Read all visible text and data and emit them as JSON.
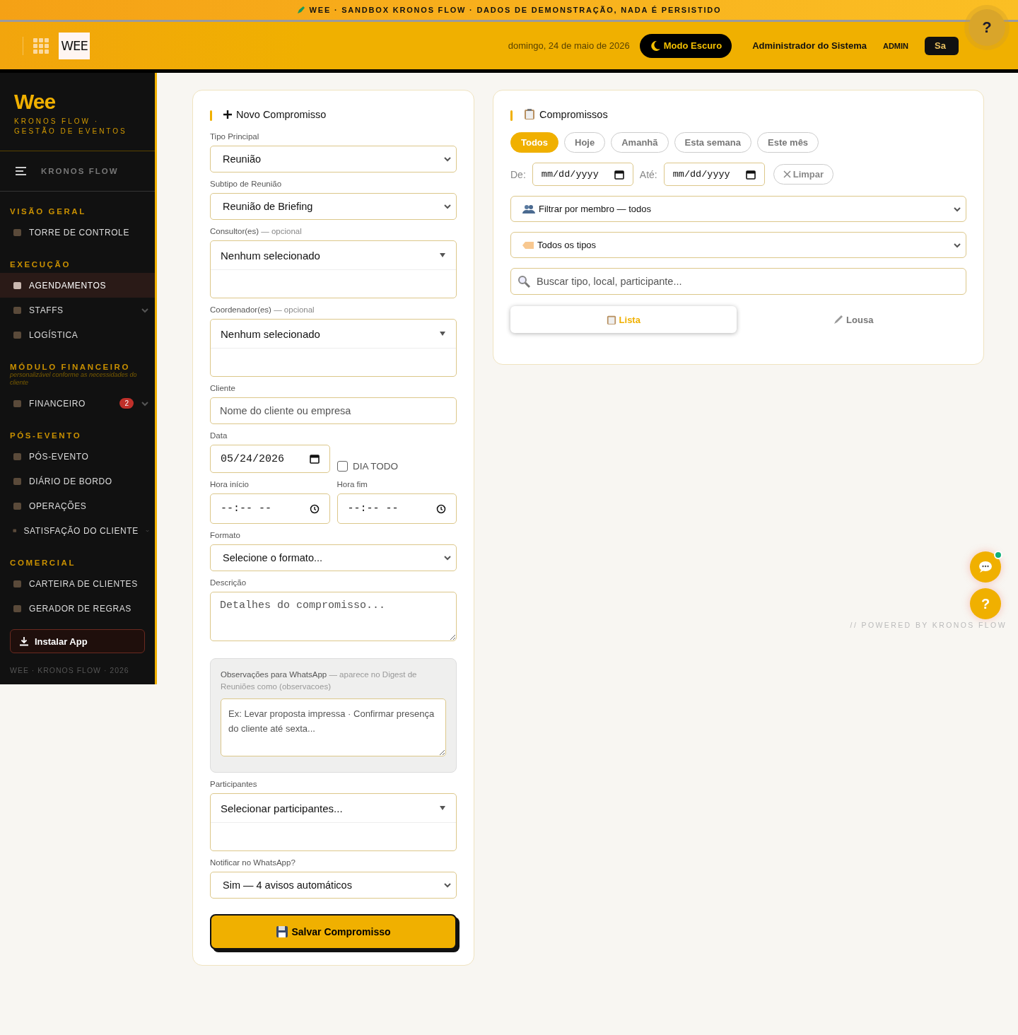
{
  "banner": {
    "text": "WEE · SANDBOX KRONOS FLOW · DADOS DE DEMONSTRAÇÃO, NADA É PERSISTIDO"
  },
  "header": {
    "logo": "WEE",
    "date": "domingo, 24 de maio de 2026",
    "dark_mode_button": "Modo Escuro",
    "user_name": "Administrador do Sistema",
    "role": "ADMIN",
    "logout_button": "Sa",
    "help_button": "?"
  },
  "sidebar": {
    "brand": "Wee",
    "tagline": "KRONOS FLOW · GESTÃO DE EVENTOS",
    "menu_label": "KRONOS FLOW",
    "sections": [
      {
        "title": "VISÃO GERAL",
        "items": [
          {
            "label": "TORRE DE CONTROLE",
            "selected": false,
            "expandable": false
          }
        ]
      },
      {
        "title": "EXECUÇÃO",
        "items": [
          {
            "label": "AGENDAMENTOS",
            "selected": true,
            "expandable": false
          },
          {
            "label": "STAFFS",
            "selected": false,
            "expandable": true
          },
          {
            "label": "LOGÍSTICA",
            "selected": false,
            "expandable": false
          }
        ]
      },
      {
        "title": "MÓDULO FINANCEIRO",
        "subtitle": "personalizável conforme as necessidades do cliente",
        "items": [
          {
            "label": "FINANCEIRO",
            "selected": false,
            "expandable": true,
            "badge": "2"
          }
        ]
      },
      {
        "title": "PÓS-EVENTO",
        "items": [
          {
            "label": "PÓS-EVENTO",
            "selected": false,
            "expandable": false
          },
          {
            "label": "DIÁRIO DE BORDO",
            "selected": false,
            "expandable": false
          },
          {
            "label": "OPERAÇÕES",
            "selected": false,
            "expandable": false
          },
          {
            "label": "SATISFAÇÃO DO CLIENTE",
            "selected": false,
            "expandable": true
          }
        ]
      },
      {
        "title": "COMERCIAL",
        "items": [
          {
            "label": "CARTEIRA DE CLIENTES",
            "selected": false,
            "expandable": false
          },
          {
            "label": "GERADOR DE REGRAS",
            "selected": false,
            "expandable": false
          }
        ]
      }
    ],
    "install_button": "Instalar App",
    "footer": "WEE · KRONOS FLOW · 2026"
  },
  "form": {
    "title": "Novo Compromisso",
    "fields": [
      {
        "kind": "select",
        "label": "Tipo Principal",
        "value": "Reunião"
      },
      {
        "kind": "select",
        "label": "Subtipo de Reunião",
        "value": "Reunião de Briefing"
      },
      {
        "kind": "multi",
        "label": "Consultor(es)",
        "hint": "— opcional",
        "value": "Nenhum selecionado"
      },
      {
        "kind": "multi",
        "label": "Coordenador(es)",
        "hint": "— opcional",
        "value": "Nenhum selecionado"
      },
      {
        "kind": "text",
        "label": "Cliente",
        "placeholder": "Nome do cliente ou empresa"
      },
      {
        "kind": "date",
        "label": "Data",
        "value": "05/24/2026",
        "checkbox": {
          "label": "DIA TODO",
          "checked": false
        }
      },
      {
        "kind": "times",
        "items": [
          {
            "label": "Hora início",
            "value": "--:-- --"
          },
          {
            "label": "Hora fim",
            "value": "--:-- --"
          }
        ]
      },
      {
        "kind": "select",
        "label": "Formato",
        "value": "Selecione o formato..."
      },
      {
        "kind": "textarea",
        "label": "Descrição",
        "placeholder": "Detalhes do compromisso..."
      },
      {
        "kind": "note",
        "label": "Observações para WhatsApp",
        "hint": "— aparece no Digest de Reuniões como (observacoes)",
        "placeholder": "Ex: Levar proposta impressa · Confirmar presença do cliente até sexta..."
      },
      {
        "kind": "multi",
        "label": "Participantes",
        "value": "Selecionar participantes..."
      },
      {
        "kind": "select",
        "label": "Notificar no WhatsApp?",
        "value": "Sim — 4 avisos automáticos"
      }
    ],
    "submit": "Salvar Compromisso"
  },
  "list": {
    "title": "Compromissos",
    "chips": [
      {
        "label": "Todos",
        "selected": true
      },
      {
        "label": "Hoje",
        "selected": false
      },
      {
        "label": "Amanhã",
        "selected": false
      },
      {
        "label": "Esta semana",
        "selected": false
      },
      {
        "label": "Este mês",
        "selected": false
      }
    ],
    "from_label": "De:",
    "from_value": "mm/dd/yyyy",
    "to_label": "Até:",
    "to_value": "mm/dd/yyyy",
    "clear_button": "Limpar",
    "member_filter": "Filtrar por membro — todos",
    "type_filter": "Todos os tipos",
    "search": {
      "placeholder": "Buscar tipo, local, participante..."
    },
    "views": [
      {
        "label": "Lista",
        "selected": true
      },
      {
        "label": "Lousa",
        "selected": false
      }
    ]
  },
  "footer": "// POWERED BY KRONOS FLOW"
}
